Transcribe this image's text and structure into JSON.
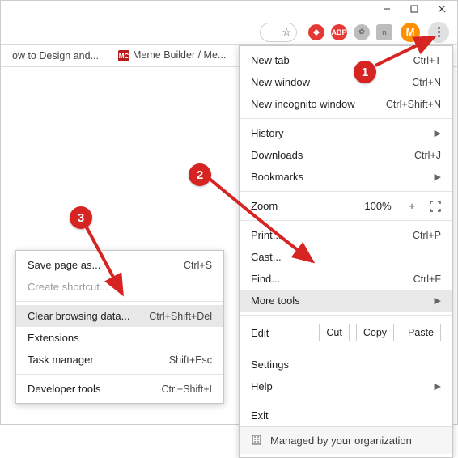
{
  "tabs": {
    "tab1": "ow to Design and...",
    "tab2_favicon": "MC",
    "tab2": "Meme Builder / Me..."
  },
  "avatar": {
    "letter": "M"
  },
  "menu": {
    "new_tab": {
      "label": "New tab",
      "shortcut": "Ctrl+T"
    },
    "new_window": {
      "label": "New window",
      "shortcut": "Ctrl+N"
    },
    "new_incognito": {
      "label": "New incognito window",
      "shortcut": "Ctrl+Shift+N"
    },
    "history": {
      "label": "History"
    },
    "downloads": {
      "label": "Downloads",
      "shortcut": "Ctrl+J"
    },
    "bookmarks": {
      "label": "Bookmarks"
    },
    "zoom": {
      "label": "Zoom",
      "value": "100%"
    },
    "print": {
      "label": "Print...",
      "shortcut": "Ctrl+P"
    },
    "cast": {
      "label": "Cast..."
    },
    "find": {
      "label": "Find...",
      "shortcut": "Ctrl+F"
    },
    "more_tools": {
      "label": "More tools"
    },
    "edit": {
      "label": "Edit",
      "cut": "Cut",
      "copy": "Copy",
      "paste": "Paste"
    },
    "settings": {
      "label": "Settings"
    },
    "help": {
      "label": "Help"
    },
    "exit": {
      "label": "Exit"
    },
    "managed": {
      "label": "Managed by your organization"
    }
  },
  "submenu": {
    "save_page": {
      "label": "Save page as...",
      "shortcut": "Ctrl+S"
    },
    "create_shortcut": {
      "label": "Create shortcut..."
    },
    "clear_data": {
      "label": "Clear browsing data...",
      "shortcut": "Ctrl+Shift+Del"
    },
    "extensions": {
      "label": "Extensions"
    },
    "task_manager": {
      "label": "Task manager",
      "shortcut": "Shift+Esc"
    },
    "dev_tools": {
      "label": "Developer tools",
      "shortcut": "Ctrl+Shift+I"
    }
  },
  "annotations": {
    "b1": "1",
    "b2": "2",
    "b3": "3"
  }
}
